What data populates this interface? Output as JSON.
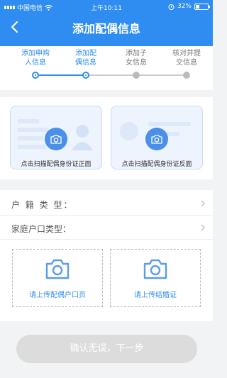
{
  "status_bar": {
    "carrier": "中国电信",
    "time": "上午10:11",
    "battery": "32%"
  },
  "nav": {
    "title": "添加配偶信息"
  },
  "steps": [
    {
      "label": "添加申购\n人信息",
      "state": "active"
    },
    {
      "label": "添加配\n偶信息",
      "state": "active"
    },
    {
      "label": "添加子\n女信息",
      "state": "inactive"
    },
    {
      "label": "核对并提\n交信息",
      "state": "inactive"
    }
  ],
  "id_cards": {
    "front_caption": "点击扫描配偶身份证正面",
    "back_caption": "点击扫描配偶身份证反面"
  },
  "form": {
    "household_type_label": "户 籍 类 型：",
    "household_register_type_label": "家庭户口类型："
  },
  "uploads": {
    "register_caption": "请上传配偶户口页",
    "marriage_caption": "请上传结婚证"
  },
  "submit": {
    "label": "确认无误，下一步"
  },
  "colors": {
    "primary": "#2f8cf0",
    "disabled_button": "#dcdcdc",
    "step_inactive": "#bbbbbb"
  }
}
